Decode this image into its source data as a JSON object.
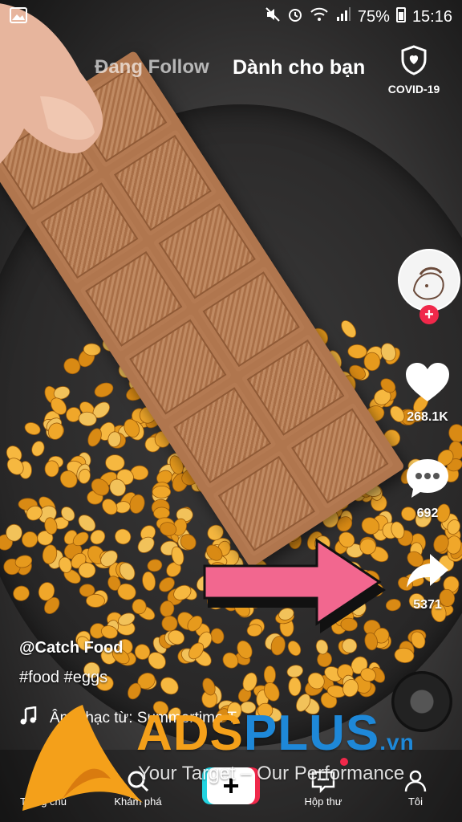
{
  "status_bar": {
    "battery": "75%",
    "time": "15:16"
  },
  "top_nav": {
    "following_tab": "Đang Follow",
    "for_you_tab": "Dành cho bạn",
    "covid_label": "COVID-19"
  },
  "rail": {
    "likes": "268.1K",
    "comments": "692",
    "shares": "5371"
  },
  "caption": {
    "username": "@Catch Food",
    "hashtags": "#food #eggs",
    "music": "Âm nhạc từ: Summertime T"
  },
  "bottom_nav": {
    "home": "Trang chủ",
    "discover": "Khám phá",
    "inbox": "Hộp thư",
    "profile": "Tôi"
  },
  "watermark": {
    "brand_main": "ADS",
    "brand_plus": "PLUS",
    "brand_tld": ".vn",
    "tagline": "Your Target – Our Performance"
  },
  "colors": {
    "accent_red": "#f0284a",
    "accent_cyan": "#22d3e0",
    "brand_orange": "#f4a01a",
    "brand_blue": "#1e88d8",
    "arrow_pink": "#f2678f"
  },
  "icons": [
    "image-icon",
    "mute-icon",
    "alarm-icon",
    "wifi-icon",
    "signal-icon",
    "shield-icon",
    "heart-icon",
    "comment-icon",
    "share-icon",
    "music-note-icon",
    "home-icon",
    "search-icon",
    "plus-icon",
    "inbox-icon",
    "profile-icon"
  ]
}
